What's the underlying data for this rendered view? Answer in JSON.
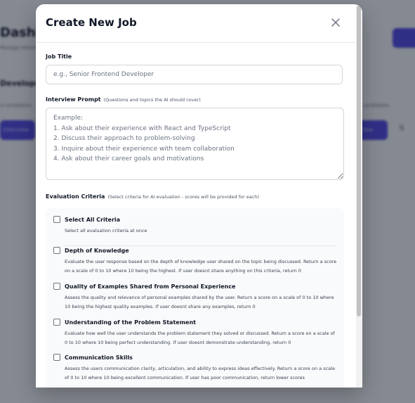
{
  "background": {
    "title": "Dashboard",
    "subtitle": "Manage interviews and job postings",
    "section_title": "Developer",
    "meta_left": "3 candidates",
    "meta_right": "candidates",
    "left_button": "Interview",
    "mid_button": "View",
    "right_icon": "⇅"
  },
  "modal": {
    "title": "Create New Job",
    "close_icon": "close-icon",
    "job_title": {
      "label": "Job Title",
      "value": "",
      "placeholder": "e.g., Senior Frontend Developer"
    },
    "interview_prompt": {
      "label": "Interview Prompt",
      "hint": "(Questions and topics the AI should cover)",
      "value": "",
      "placeholder": "Example:\n1. Ask about their experience with React and TypeScript\n2. Discuss their approach to problem-solving\n3. Inquire about their experience with team collaboration\n4. Ask about their career goals and motivations"
    },
    "evaluation": {
      "label": "Evaluation Criteria",
      "hint": "(Select criteria for AI evaluation - scores will be provided for each)",
      "criteria": [
        {
          "title": "Select All Criteria",
          "description": "Select all evaluation criteria at once",
          "checked": false
        },
        {
          "title": "Depth of Knowledge",
          "description": "Evaluate the user response based on the depth of knowledge user shared on the topic being discussed. Return a score on a scale of 0 to 10 where 10 being the highest. If user doesnt share anything on this criteria, return 0",
          "checked": false
        },
        {
          "title": "Quality of Examples Shared from Personal Experience",
          "description": "Assess the quality and relevance of personal examples shared by the user. Return a score on a scale of 0 to 10 where 10 being the highest quality examples. If user doesnt share any examples, return 0",
          "checked": false
        },
        {
          "title": "Understanding of the Problem Statement",
          "description": "Evaluate how well the user understands the problem statement they solved or discussed. Return a score on a scale of 0 to 10 where 10 being perfect understanding. If user doesnt demonstrate understanding, return 0",
          "checked": false
        },
        {
          "title": "Communication Skills",
          "description": "Assess the users communication clarity, articulation, and ability to express ideas effectively. Return a score on a scale of 0 to 10 where 10 being excellent communication. If user has poor communication, return lower scores",
          "checked": false
        }
      ]
    }
  },
  "colors": {
    "accent": "#4f46e5",
    "overlay": "#111827",
    "text": "#111827",
    "border": "#d1d5db"
  }
}
